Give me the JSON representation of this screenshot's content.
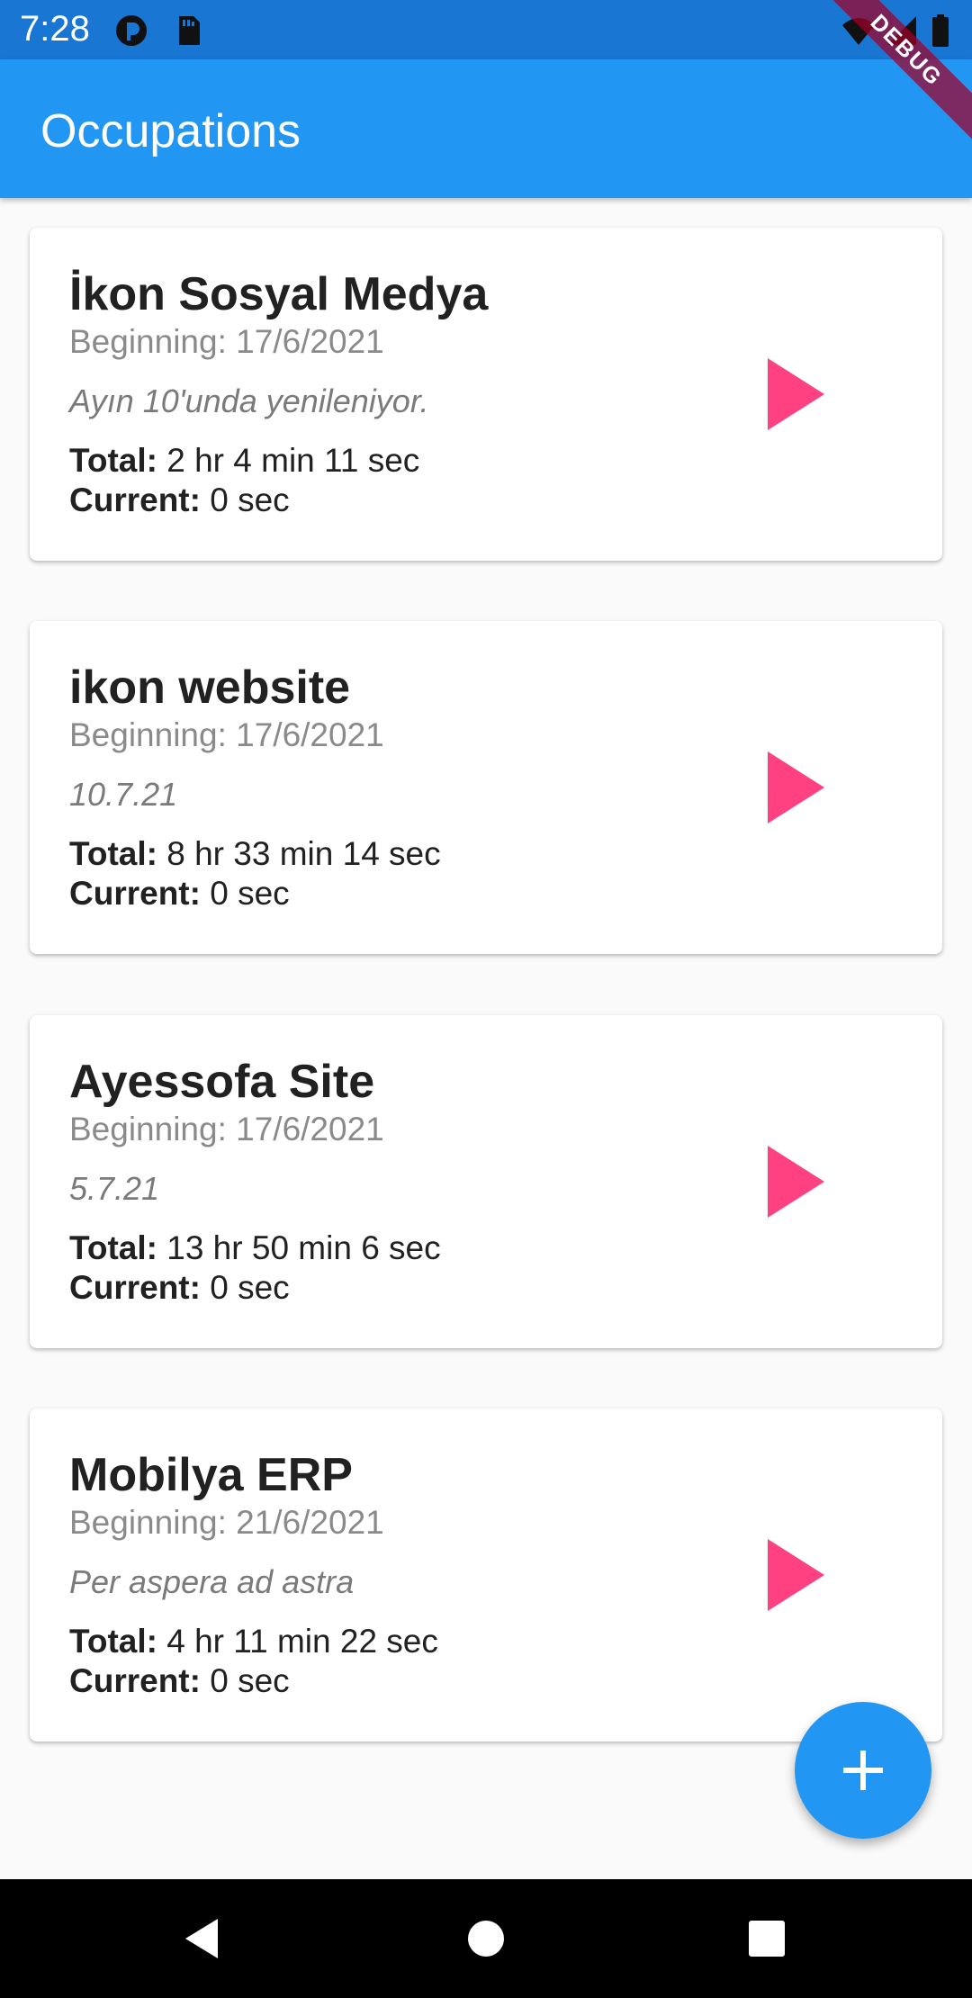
{
  "status_bar": {
    "time": "7:28",
    "left_icons": [
      "app-notification-icon",
      "sd-card-icon"
    ],
    "right_icons": [
      "wifi-icon",
      "signal-icon",
      "battery-icon"
    ]
  },
  "debug_banner": "DEBUG",
  "app_bar": {
    "title": "Occupations"
  },
  "labels": {
    "total": "Total:",
    "current": "Current:"
  },
  "occupations": [
    {
      "title": "İkon Sosyal Medya",
      "beginning": "Beginning: 17/6/2021",
      "note": "Ayın 10'unda yenileniyor.",
      "total": "2 hr 4 min 11 sec",
      "current": "0 sec"
    },
    {
      "title": "ikon website",
      "beginning": "Beginning: 17/6/2021",
      "note": "10.7.21",
      "total": "8 hr 33 min 14 sec",
      "current": "0 sec"
    },
    {
      "title": "Ayessofa Site",
      "beginning": "Beginning: 17/6/2021",
      "note": "5.7.21",
      "total": "13 hr 50 min 6 sec",
      "current": "0 sec"
    },
    {
      "title": "Mobilya ERP",
      "beginning": "Beginning: 21/6/2021",
      "note": "Per aspera ad astra",
      "total": "4 hr 11 min 22 sec",
      "current": "0 sec"
    }
  ],
  "icons": {
    "play": "play-icon",
    "fab": "add-icon",
    "nav": [
      "back-icon",
      "home-icon",
      "recents-icon"
    ]
  },
  "colors": {
    "status_bar": "#1976d2",
    "app_bar": "#2196f3",
    "accent": "#ff4081",
    "fab": "#2196f3",
    "background": "#fafafa"
  }
}
